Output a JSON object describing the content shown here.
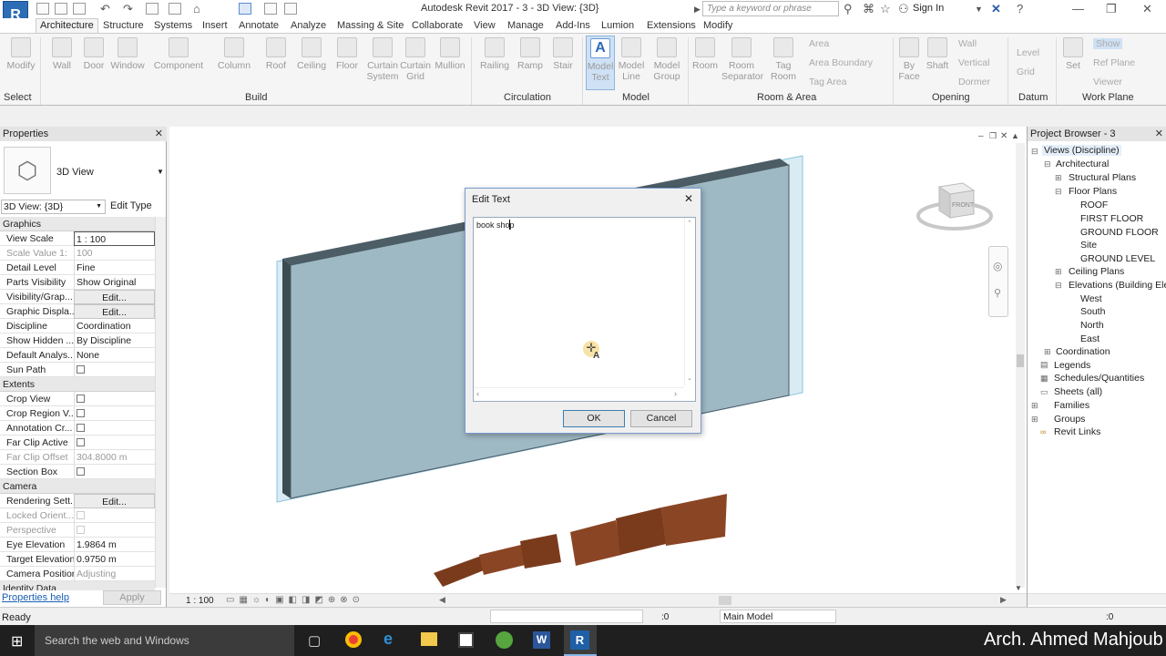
{
  "app": {
    "title": "Autodesk Revit 2017 -    3 - 3D View: {3D}",
    "search_placeholder": "Type a keyword or phrase",
    "sign_in": "Sign In",
    "logo": "R"
  },
  "tabs": [
    "Architecture",
    "Structure",
    "Systems",
    "Insert",
    "Annotate",
    "Analyze",
    "Massing & Site",
    "Collaborate",
    "View",
    "Manage",
    "Add-Ins",
    "Lumion",
    "Extensions",
    "Modify"
  ],
  "ribbon": {
    "build": [
      "Modify",
      "Wall",
      "Door",
      "Window",
      "Component",
      "Column",
      "Roof",
      "Ceiling",
      "Floor",
      "Curtain System",
      "Curtain Grid",
      "Mullion"
    ],
    "circulation": [
      "Railing",
      "Ramp",
      "Stair"
    ],
    "model": [
      "Model Text",
      "Model Line",
      "Model Group"
    ],
    "room": [
      "Room",
      "Room Separator",
      "Tag Room"
    ],
    "room_small": [
      "Area",
      "Area Boundary",
      "Tag Area"
    ],
    "opening": [
      "By Face",
      "Shaft"
    ],
    "opening_small": [
      "Wall",
      "Vertical",
      "Dormer"
    ],
    "datum": [
      "Level",
      "Grid"
    ],
    "workplane": [
      "Set"
    ],
    "workplane_small": [
      "Show",
      "Ref Plane",
      "Viewer"
    ],
    "panels": [
      "Select",
      "Build",
      "Circulation",
      "Model",
      "Room & Area",
      "Opening",
      "Datum",
      "Work Plane"
    ]
  },
  "properties": {
    "title": "Properties",
    "type_name": "3D View",
    "selector": "3D View: {3D}",
    "edit_type": "Edit Type",
    "groups": {
      "graphics": "Graphics",
      "extents": "Extents",
      "camera": "Camera",
      "identity": "Identity Data"
    },
    "rows": [
      {
        "k": "View Scale",
        "v": "1 : 100"
      },
      {
        "k": "Scale Value    1:",
        "v": "100"
      },
      {
        "k": "Detail Level",
        "v": "Fine"
      },
      {
        "k": "Parts Visibility",
        "v": "Show Original"
      },
      {
        "k": "Visibility/Grap...",
        "v": "Edit..."
      },
      {
        "k": "Graphic Displa...",
        "v": "Edit..."
      },
      {
        "k": "Discipline",
        "v": "Coordination"
      },
      {
        "k": "Show Hidden ...",
        "v": "By Discipline"
      },
      {
        "k": "Default Analys...",
        "v": "None"
      },
      {
        "k": "Sun Path",
        "v": ""
      },
      {
        "k": "Crop View",
        "v": ""
      },
      {
        "k": "Crop Region V...",
        "v": ""
      },
      {
        "k": "Annotation Cr...",
        "v": ""
      },
      {
        "k": "Far Clip Active",
        "v": ""
      },
      {
        "k": "Far Clip Offset",
        "v": "304.8000 m"
      },
      {
        "k": "Section Box",
        "v": ""
      },
      {
        "k": "Rendering Sett...",
        "v": "Edit..."
      },
      {
        "k": "Locked Orient...",
        "v": ""
      },
      {
        "k": "Perspective",
        "v": ""
      },
      {
        "k": "Eye Elevation",
        "v": "1.9864 m"
      },
      {
        "k": "Target Elevation",
        "v": "0.9750 m"
      },
      {
        "k": "Camera Position",
        "v": "Adjusting"
      }
    ],
    "help": "Properties help",
    "apply": "Apply"
  },
  "project_browser": {
    "title": "Project Browser - 3",
    "nodes": [
      "Views (Discipline)",
      "Architectural",
      "Structural Plans",
      "Floor Plans",
      "ROOF",
      "FIRST FLOOR",
      "GROUND FLOOR",
      "Site",
      "GROUND LEVEL",
      "Ceiling Plans",
      "Elevations (Building Ele",
      "West",
      "South",
      "North",
      "East",
      "Coordination",
      "Legends",
      "Schedules/Quantities",
      "Sheets (all)",
      "Families",
      "Groups",
      "Revit Links"
    ]
  },
  "viewcube": {
    "face": "FRONT"
  },
  "model_text_3d": "revit course",
  "dialog": {
    "title": "Edit Text",
    "text": "book shop",
    "ok": "OK",
    "cancel": "Cancel"
  },
  "view_scale_bar": "1 : 100",
  "status": {
    "ready": "Ready",
    "zero": ":0",
    "model": "Main Model",
    "filter": ":0"
  },
  "taskbar": {
    "search": "Search the web and Windows",
    "watermark": "Arch. Ahmed Mahjoub"
  }
}
